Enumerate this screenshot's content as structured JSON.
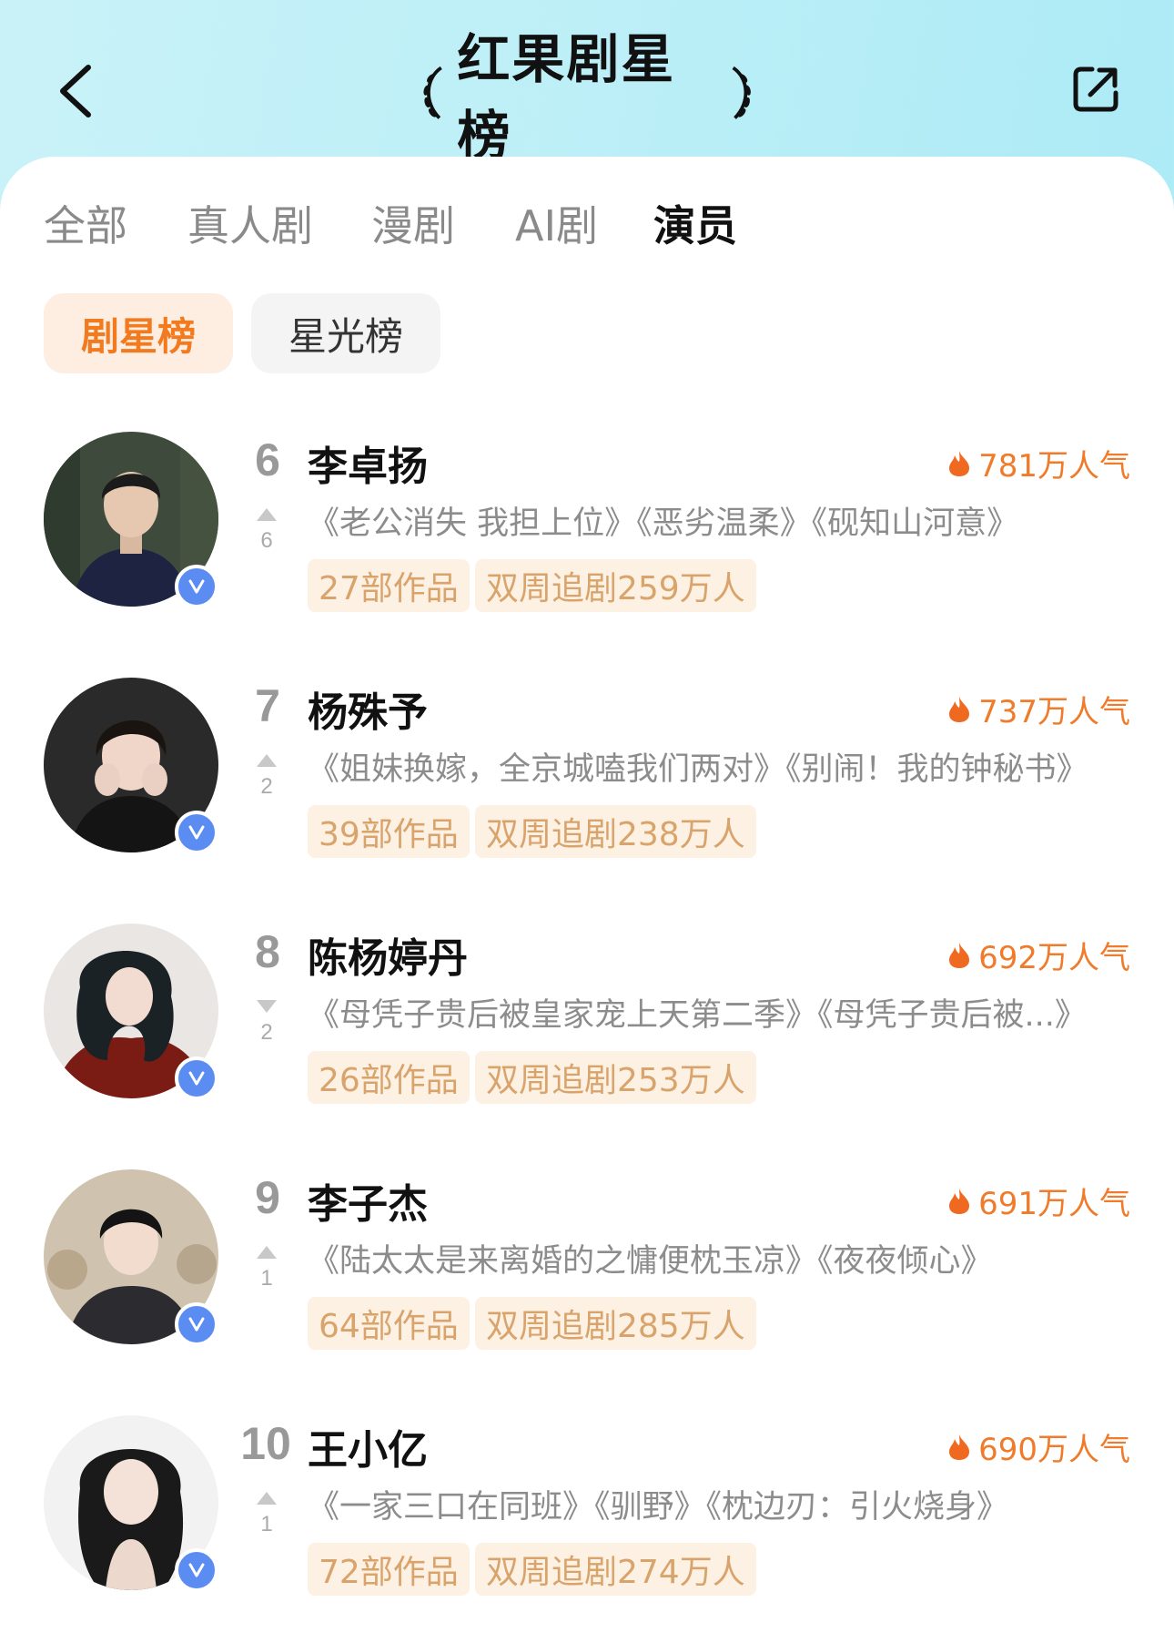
{
  "header": {
    "title": "红果剧星榜",
    "back_icon": "chevron-left-icon",
    "share_icon": "share-icon"
  },
  "tabs": [
    {
      "label": "全部",
      "active": false
    },
    {
      "label": "真人剧",
      "active": false
    },
    {
      "label": "漫剧",
      "active": false
    },
    {
      "label": "AI剧",
      "active": false
    },
    {
      "label": "演员",
      "active": true
    }
  ],
  "subtabs": [
    {
      "label": "剧星榜",
      "active": true
    },
    {
      "label": "星光榜",
      "active": false
    }
  ],
  "colors": {
    "accent": "#ef7b2b",
    "tag_bg": "#fdf1e4",
    "tag_text": "#d9a46c",
    "verified_badge": "#5a8cf2"
  },
  "list": [
    {
      "rank": "6",
      "trend": "up",
      "trend_num": "6",
      "name": "李卓扬",
      "popularity": "781万人气",
      "works": "《老公消失 我担上位》《恶劣温柔》《砚知山河意》",
      "work_count": "27部作品",
      "followers": "双周追剧259万人"
    },
    {
      "rank": "7",
      "trend": "up",
      "trend_num": "2",
      "name": "杨殊予",
      "popularity": "737万人气",
      "works": "《姐妹换嫁，全京城嗑我们两对》《别闹！我的钟秘书》",
      "work_count": "39部作品",
      "followers": "双周追剧238万人"
    },
    {
      "rank": "8",
      "trend": "down",
      "trend_num": "2",
      "name": "陈杨婷丹",
      "popularity": "692万人气",
      "works": "《母凭子贵后被皇家宠上天第二季》《母凭子贵后被...》",
      "work_count": "26部作品",
      "followers": "双周追剧253万人"
    },
    {
      "rank": "9",
      "trend": "up",
      "trend_num": "1",
      "name": "李子杰",
      "popularity": "691万人气",
      "works": "《陆太太是来离婚的之慵便枕玉凉》《夜夜倾心》",
      "work_count": "64部作品",
      "followers": "双周追剧285万人"
    },
    {
      "rank": "10",
      "trend": "up",
      "trend_num": "1",
      "name": "王小亿",
      "popularity": "690万人气",
      "works": "《一家三口在同班》《驯野》《枕边刃：引火烧身》",
      "work_count": "72部作品",
      "followers": "双周追剧274万人"
    }
  ]
}
